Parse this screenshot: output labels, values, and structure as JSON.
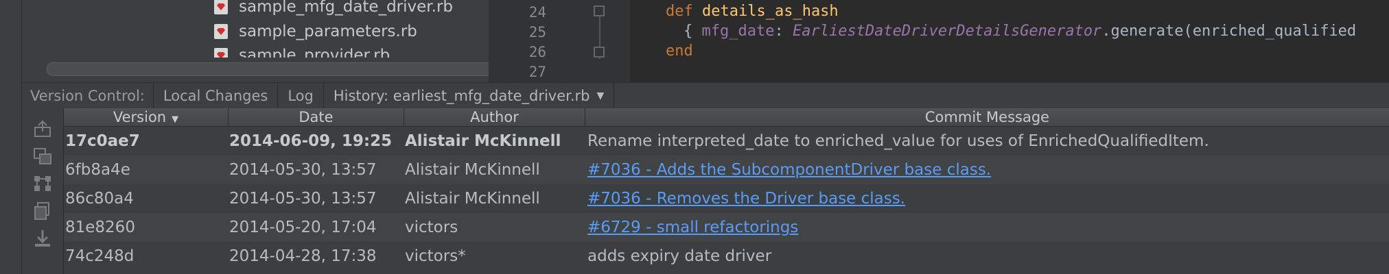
{
  "project_tree": {
    "files": [
      "sample_mfg_date_driver.rb",
      "sample_parameters.rb",
      "sample_provider.rb"
    ]
  },
  "editor": {
    "line_numbers": [
      "24",
      "25",
      "26",
      "27"
    ],
    "line24": {
      "kw": "def",
      "name": "details_as_hash"
    },
    "line25": {
      "open": "{ ",
      "symbol": "mfg_date",
      "colon": ": ",
      "cls": "EarliestDateDriverDetailsGenerator",
      "rest": ".generate(enriched_qualified"
    },
    "line26": {
      "kw": "end"
    }
  },
  "version_control": {
    "label": "Version Control:",
    "tabs": [
      "Local Changes",
      "Log",
      "History: earliest_mfg_date_driver.rb"
    ]
  },
  "history_table": {
    "columns": [
      "Version",
      "Date",
      "Author",
      "Commit Message"
    ],
    "sort_indicator": "▼",
    "rows": [
      {
        "version": "17c0ae7",
        "date": "2014-06-09, 19:25",
        "author": "Alistair McKinnell",
        "message": "Rename interpreted_date to enriched_value for uses of EnrichedQualifiedItem.",
        "bold": true,
        "link": false
      },
      {
        "version": "6fb8a4e",
        "date": "2014-05-30, 13:57",
        "author": "Alistair McKinnell",
        "message": "#7036 - Adds the SubcomponentDriver base class.",
        "bold": false,
        "link": true
      },
      {
        "version": "86c80a4",
        "date": "2014-05-30, 13:57",
        "author": "Alistair McKinnell",
        "message": "#7036 - Removes the Driver base class.",
        "bold": false,
        "link": true
      },
      {
        "version": "81e8260",
        "date": "2014-05-20, 17:04",
        "author": "victors",
        "message": "#6729 - small refactorings",
        "bold": false,
        "link": true
      },
      {
        "version": "74c248d",
        "date": "2014-04-28, 17:38",
        "author": "victors*",
        "message": "adds expiry date driver",
        "bold": false,
        "link": false
      }
    ]
  },
  "toolbar_icons": [
    "share-icon",
    "compare-icon",
    "structure-icon",
    "copy-icon",
    "download-icon"
  ],
  "colors": {
    "link": "#5a9cf5",
    "keyword": "#cc7832",
    "function": "#ffc66d",
    "symbol": "#9876aa"
  }
}
